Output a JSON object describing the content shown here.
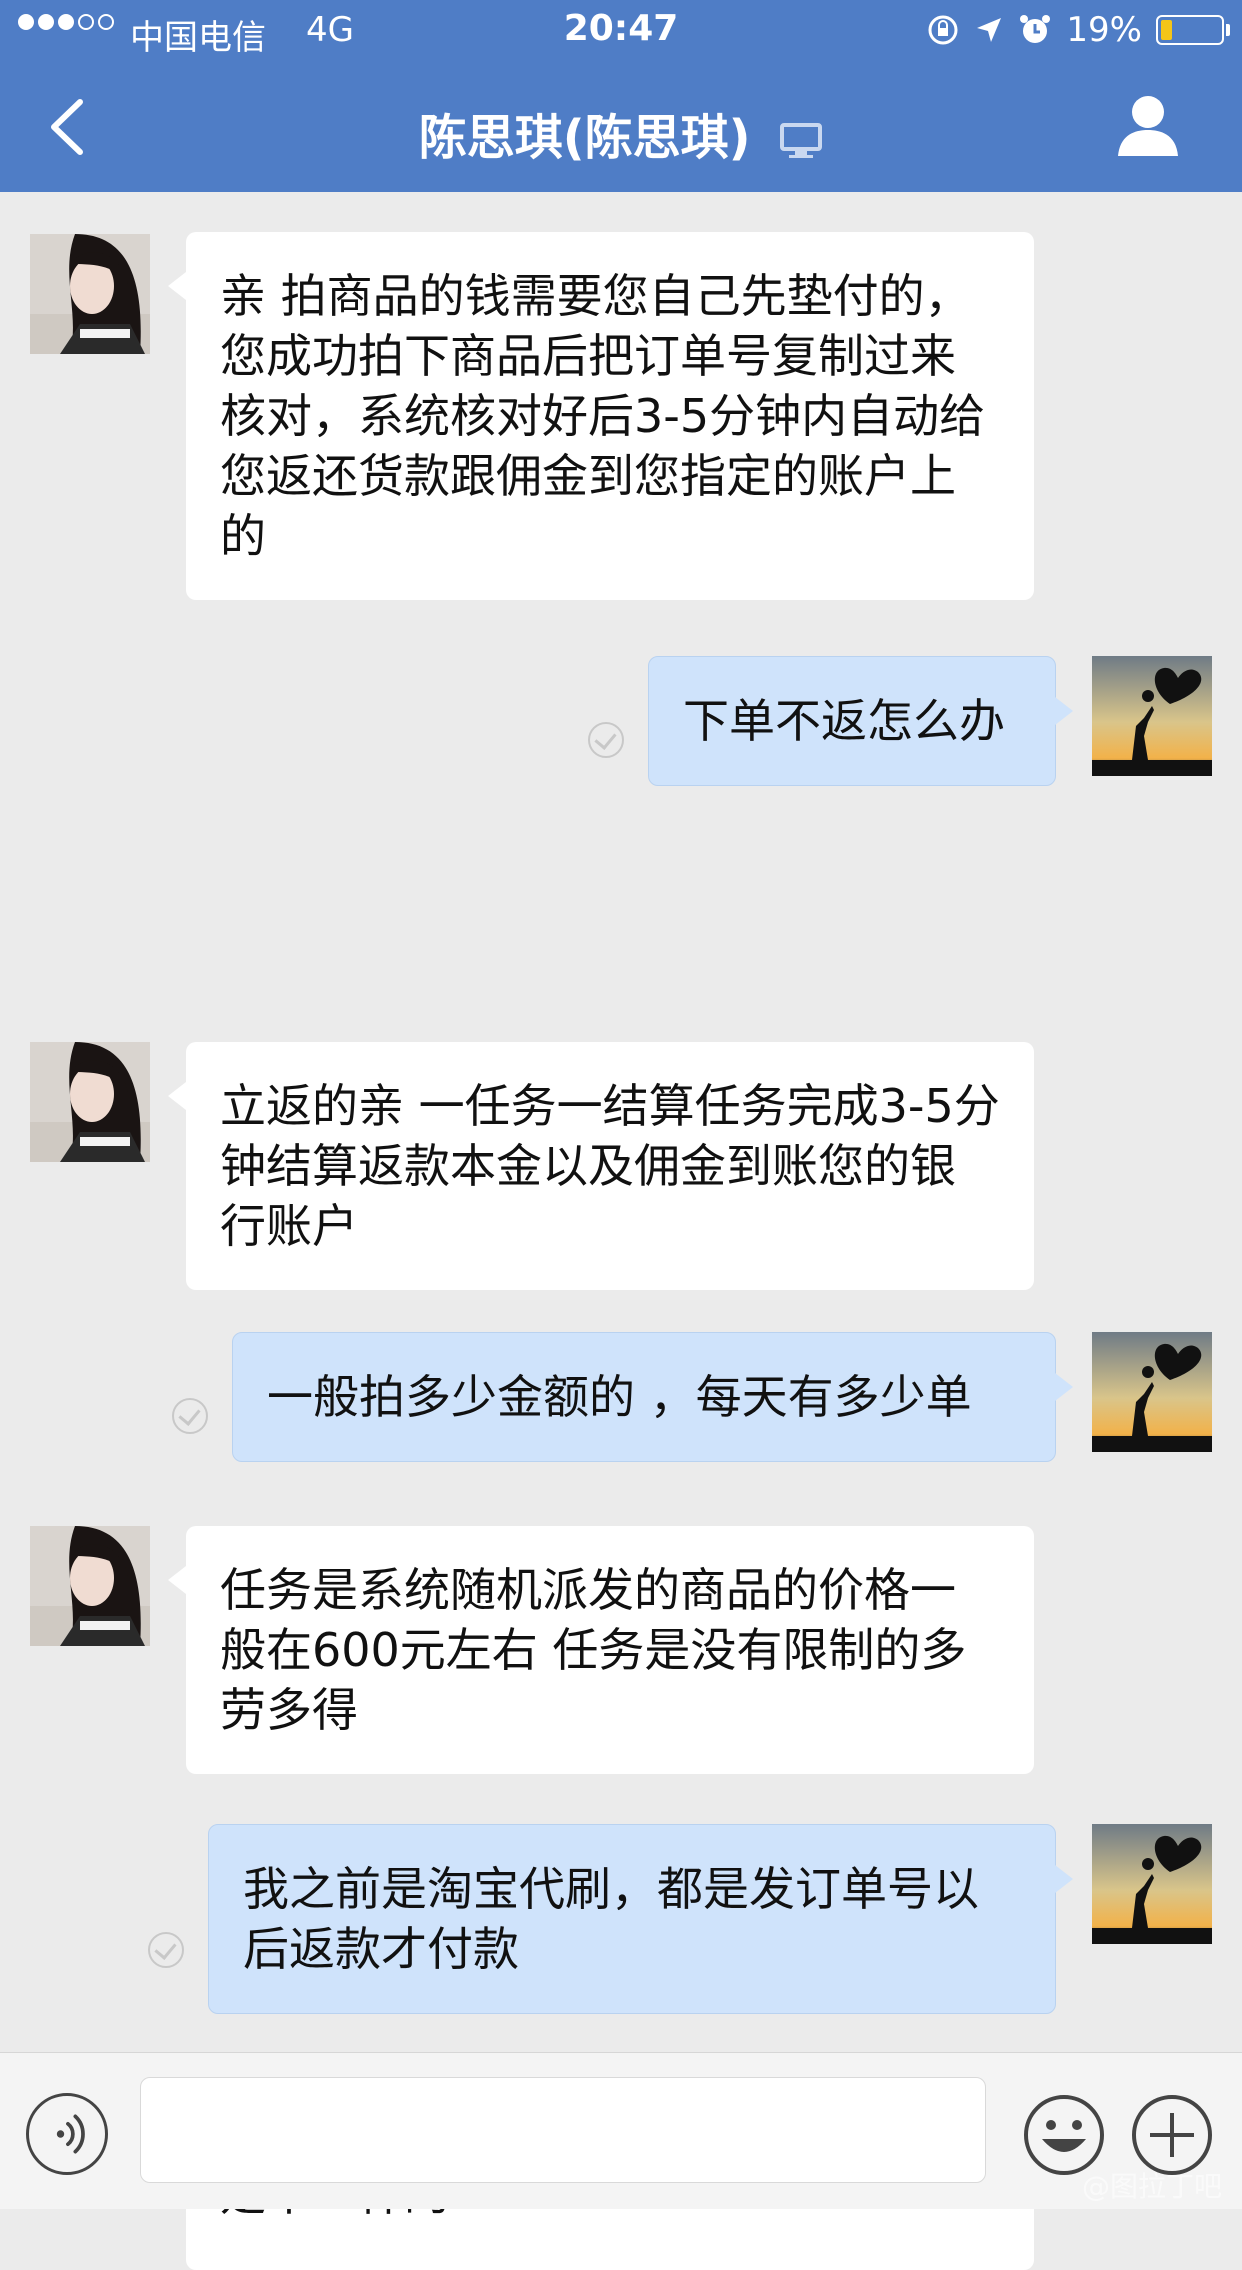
{
  "status_bar": {
    "carrier": "中国电信",
    "network": "4G",
    "time": "20:47",
    "battery_text": "19%",
    "battery_level": 0.19,
    "signal_bars_filled": 3,
    "signal_bars_total": 5
  },
  "nav": {
    "title": "陈思琪(陈思琪)",
    "back_icon": "chevron-left-icon",
    "profile_icon": "user-icon",
    "device_icon": "desktop-icon"
  },
  "messages": [
    {
      "side": "left",
      "text": "亲 拍商品的钱需要您自己先垫付的，您成功拍下商品后把订单号复制过来核对，系统核对好后3-5分钟内自动给您返还货款跟佣金到您指定的账户上的"
    },
    {
      "side": "right",
      "text": "下单不返怎么办"
    },
    {
      "side": "left",
      "text": "立返的亲 一任务一结算任务完成3-5分钟结算返款本金以及佣金到账您的银行账户"
    },
    {
      "side": "right",
      "text": "一般拍多少金额的 ，每天有多少单"
    },
    {
      "side": "left",
      "text": "任务是系统随机派发的商品的价格一般在600元左右 任务是没有限制的多劳多得"
    },
    {
      "side": "right",
      "text": "我之前是淘宝代刷，都是发订单号以后返款才付款"
    },
    {
      "side": "left",
      "text": "亲每个平台的操作方式不一样佣金也是不一样的"
    }
  ],
  "input_bar": {
    "value": "",
    "voice_icon": "voice-icon",
    "emoji_icon": "emoji-icon",
    "plus_icon": "plus-icon"
  },
  "watermark": "@图拉丁吧",
  "colors": {
    "nav_bg": "#4f7dc6",
    "chat_bg": "#ebebeb",
    "bubble_left": "#ffffff",
    "bubble_right": "#cfe3fb"
  }
}
